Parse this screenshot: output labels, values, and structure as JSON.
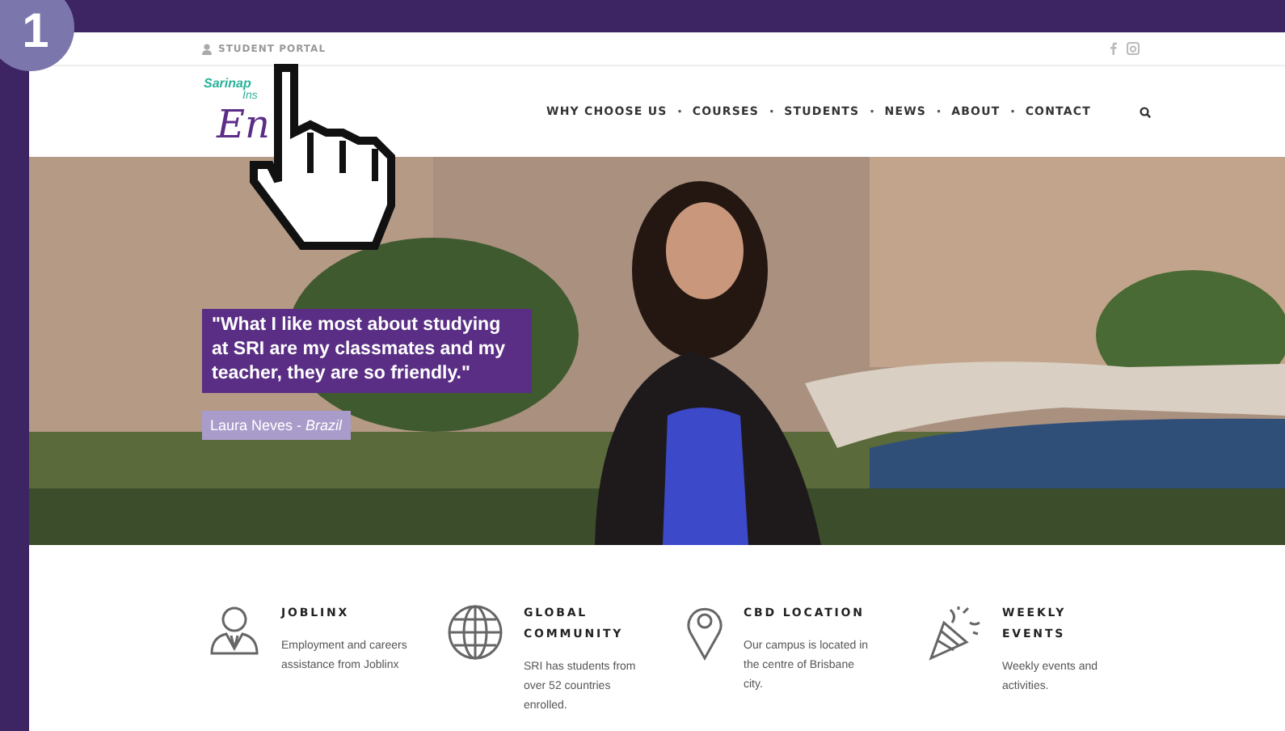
{
  "badge": "1",
  "top_bar": {
    "portal_link": "STUDENT PORTAL"
  },
  "logo": {
    "line_1": "Sarinap",
    "line_2": "Ins",
    "line_3": "En"
  },
  "nav": {
    "items": [
      {
        "label": "WHY CHOOSE US"
      },
      {
        "label": "COURSES"
      },
      {
        "label": "STUDENTS"
      },
      {
        "label": "NEWS"
      },
      {
        "label": "ABOUT"
      },
      {
        "label": "CONTACT"
      }
    ],
    "separator": "•"
  },
  "hero": {
    "kind": "picture",
    "quote": "\"What I like most about studying at SRI are my classmates and my teacher, they are so friendly.\"",
    "author": "Laura Neves - *Brazil*"
  },
  "features": [
    {
      "kind": "person",
      "title": "JOBLINX",
      "text": "Employment and careers assistance from Joblinx"
    },
    {
      "kind": "globe",
      "title": "GLOBAL COMMUNITY",
      "text": "SRI has students from over 52 countries enrolled."
    },
    {
      "kind": "pin",
      "title": "CBD LOCATION",
      "text": "Our campus is located in the centre of Brisbane city."
    },
    {
      "kind": "party",
      "title": "WEEKLY EVENTS",
      "text": "Weekly events and activities."
    }
  ]
}
